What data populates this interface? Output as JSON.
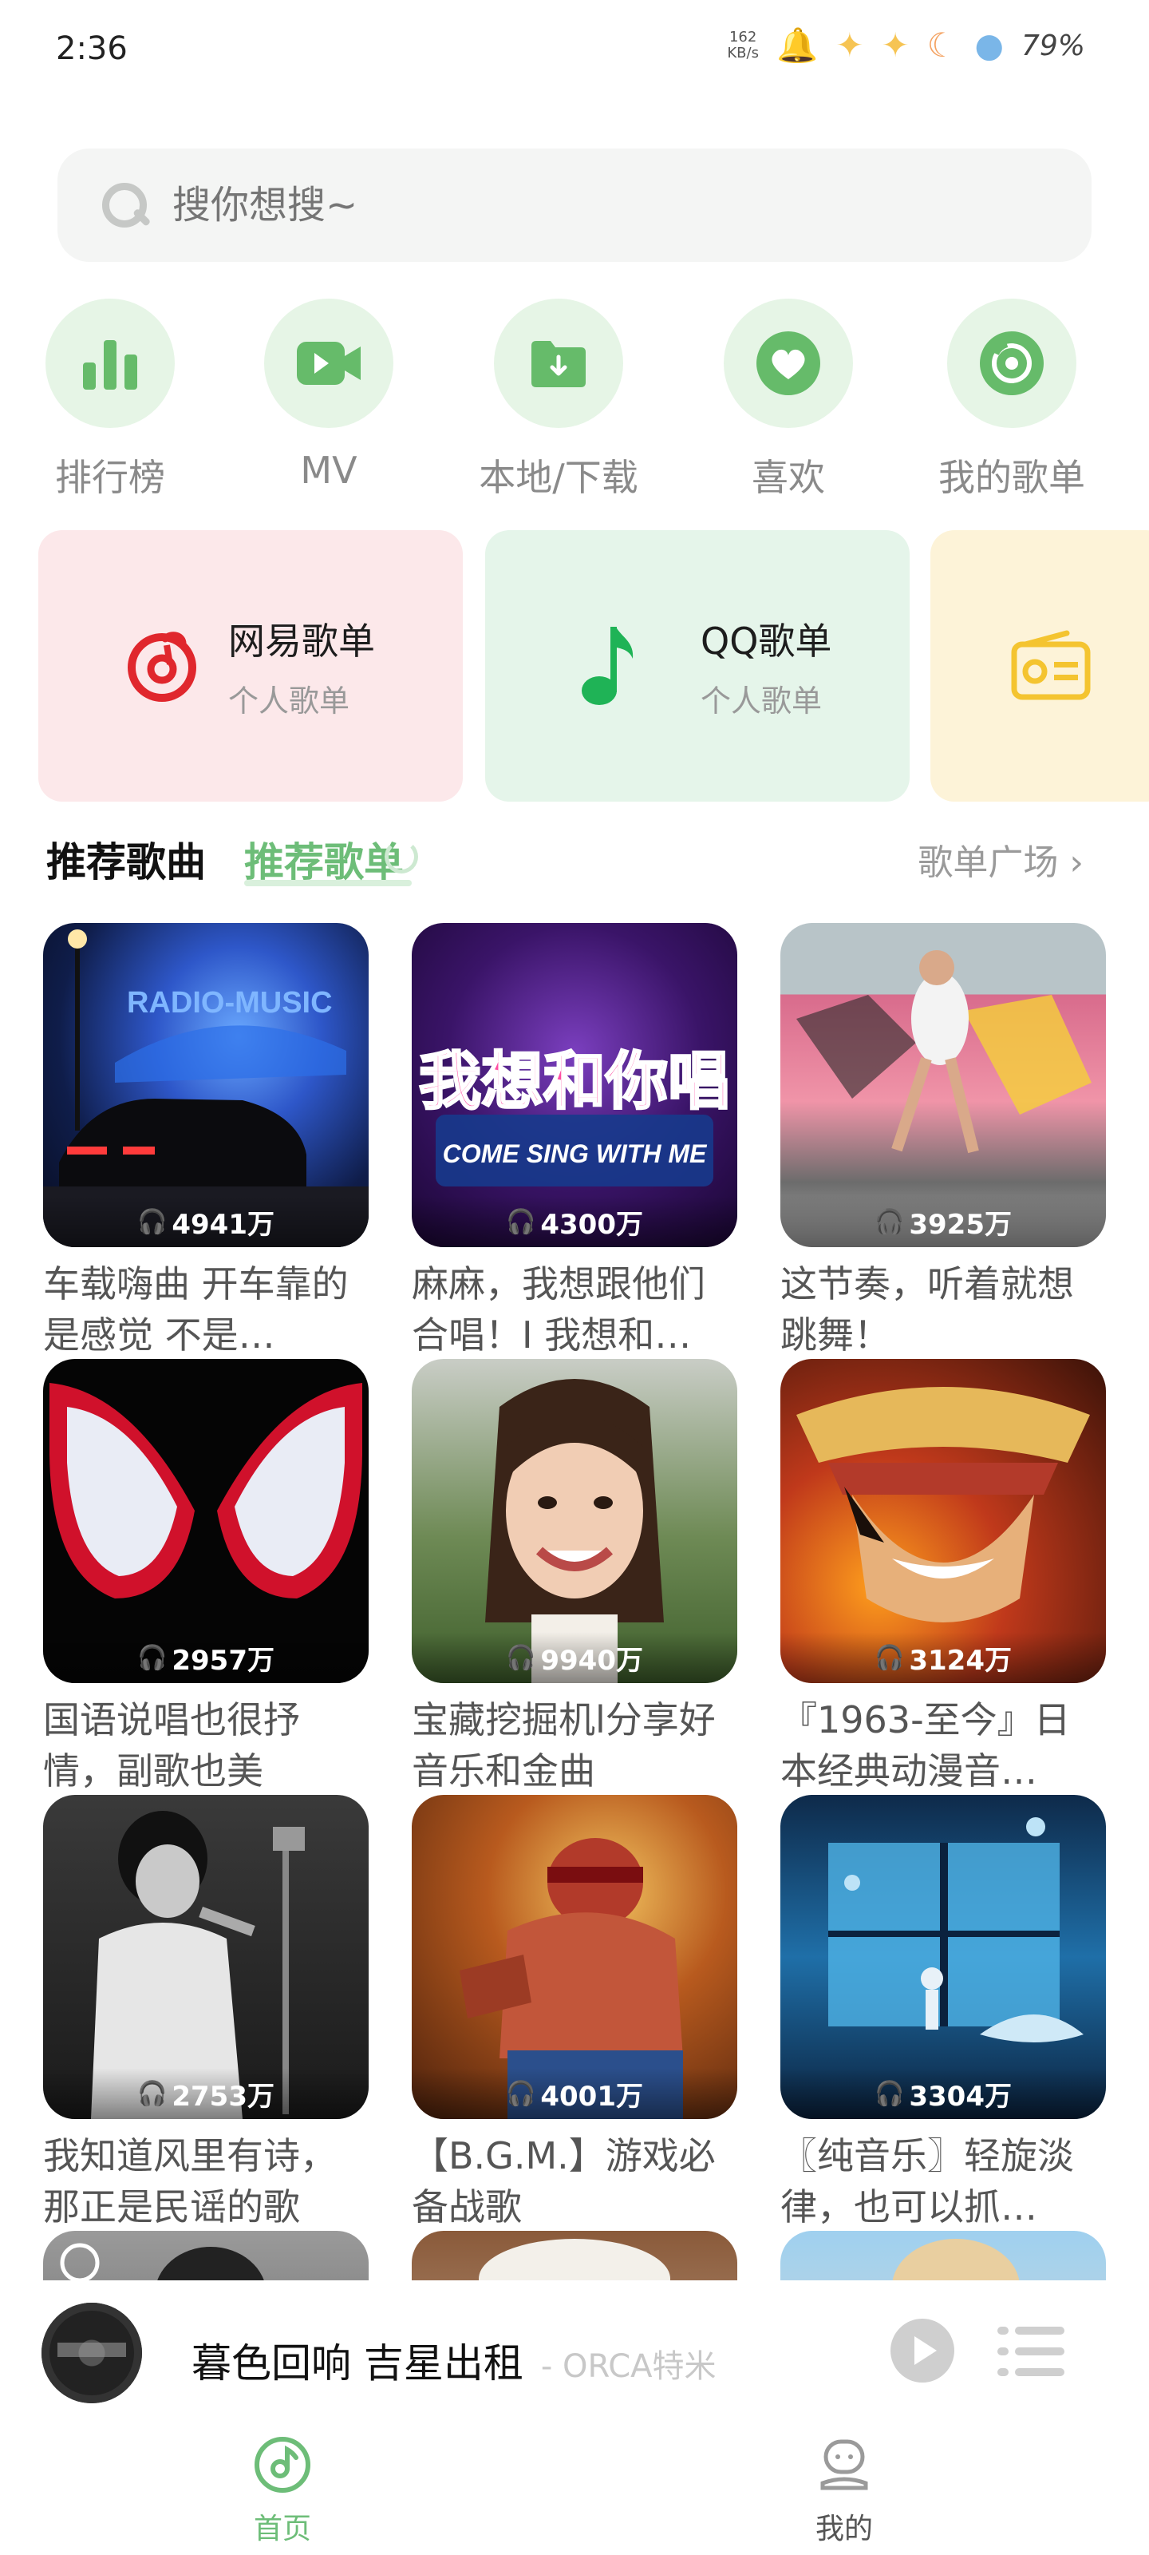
{
  "status_bar": {
    "time": "2:36",
    "net_speed_value": "162",
    "net_speed_unit": "KB/s",
    "battery": "79%"
  },
  "search": {
    "placeholder": "搜你想搜~"
  },
  "quick_entries": [
    {
      "label": "排行榜",
      "icon": "chart-bars-icon"
    },
    {
      "label": "MV",
      "icon": "video-icon"
    },
    {
      "label": "本地/下载",
      "icon": "download-folder-icon"
    },
    {
      "label": "喜欢",
      "icon": "heart-icon"
    },
    {
      "label": "我的歌单",
      "icon": "playlist-disc-icon"
    }
  ],
  "source_cards": [
    {
      "title": "网易歌单",
      "subtitle": "个人歌单",
      "icon": "netease-icon",
      "bg": "#fce8ea",
      "accent": "#e0272d"
    },
    {
      "title": "QQ歌单",
      "subtitle": "个人歌单",
      "icon": "qq-music-note-icon",
      "bg": "#e5f5ea",
      "accent": "#1fb356"
    },
    {
      "icon": "radio-icon",
      "bg": "#fdf3d8",
      "accent": "#f4c430"
    }
  ],
  "section": {
    "tab_songs": "推荐歌曲",
    "tab_playlists": "推荐歌单",
    "plaza": "歌单广场 ›"
  },
  "playlists": [
    {
      "plays": "4941万",
      "title": "车载嗨曲 开车靠的是感觉 不是…"
    },
    {
      "plays": "4300万",
      "title": "麻麻，我想跟他们合唱！I 我想和…"
    },
    {
      "plays": "3925万",
      "title": "这节奏，听着就想跳舞！"
    },
    {
      "plays": "2957万",
      "title": "国语说唱也很抒情，副歌也美"
    },
    {
      "plays": "9940万",
      "title": "宝藏挖掘机l分享好音乐和金曲"
    },
    {
      "plays": "3124万",
      "title": "『1963-至今』日本经典动漫音…"
    },
    {
      "plays": "2753万",
      "title": "我知道风里有诗，那正是民谣的歌"
    },
    {
      "plays": "4001万",
      "title": "【B.G.M.】游戏必备战歌"
    },
    {
      "plays": "3304万",
      "title": "〖纯音乐〗轻旋淡律，也可以抓…"
    }
  ],
  "cover_texts": {
    "radio": "RADIO-MUSIC",
    "sing_big": "我想和你唱",
    "sing_small": "COME SING WITH ME"
  },
  "player": {
    "song": "暮色回响 吉星出租",
    "artist": "- ORCA特米"
  },
  "nav": {
    "home": "首页",
    "mine": "我的",
    "active_color": "#6dbd78"
  }
}
